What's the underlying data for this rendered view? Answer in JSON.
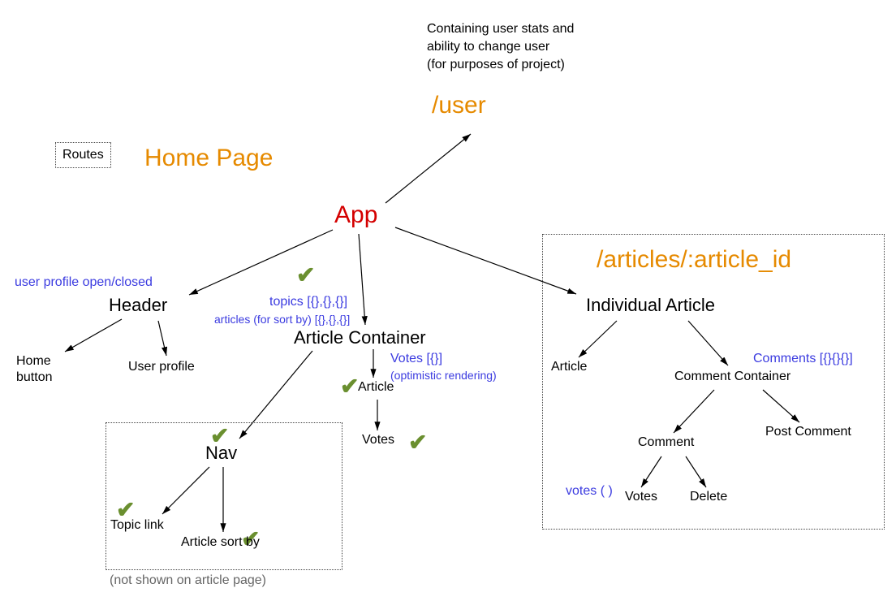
{
  "routes_label": "Routes",
  "home_page": "Home Page",
  "app": "App",
  "user_route": "/user",
  "user_desc_line1": "Containing user stats and",
  "user_desc_line2": "ability to change user",
  "user_desc_line3": "(for purposes of project)",
  "individual_article_route": "/articles/:article_id",
  "header": "Header",
  "user_profile_note": "user profile open/closed",
  "home_button_line1": "Home",
  "home_button_line2": "button",
  "user_profile": "User profile",
  "article_container": "Article Container",
  "topics_note": "topics [{},{},{}]",
  "articles_sort_note": "articles (for sort by) [{},{},{}]",
  "article": "Article",
  "votes_note1": "Votes [{}]",
  "votes_note2": "(optimistic rendering)",
  "votes": "Votes",
  "nav": "Nav",
  "topic_link": "Topic link",
  "article_sort_by": "Article sort by",
  "nav_footer_note": "(not shown on article page)",
  "individual_article": "Individual Article",
  "article2": "Article",
  "comment_container": "Comment Container",
  "comments_note": "Comments [{}{}{}]",
  "comment": "Comment",
  "post_comment": "Post Comment",
  "votes2": "Votes",
  "votes_paren": "votes ( )",
  "delete": "Delete"
}
